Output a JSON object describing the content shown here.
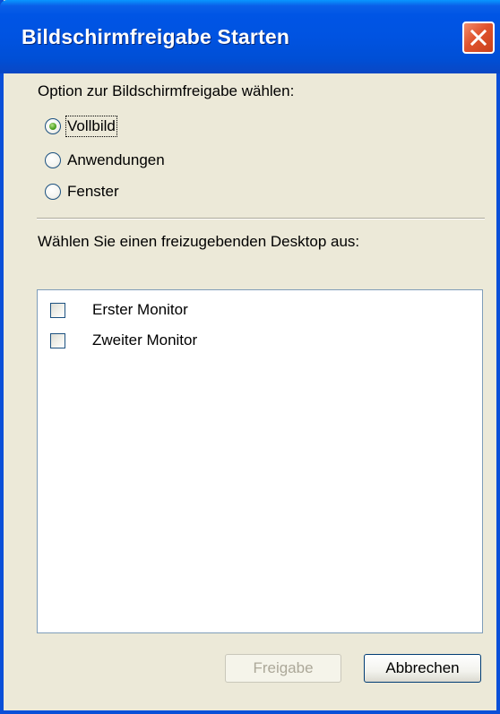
{
  "window": {
    "title": "Bildschirmfreigabe Starten",
    "close_icon": "close-x-icon"
  },
  "share_option": {
    "heading": "Option zur Bildschirmfreigabe wählen:",
    "options": [
      {
        "label": "Vollbild",
        "checked": true
      },
      {
        "label": "Anwendungen",
        "checked": false
      },
      {
        "label": "Fenster",
        "checked": false
      }
    ]
  },
  "desktop_select": {
    "heading": "Wählen Sie einen freizugebenden Desktop aus:",
    "monitors": [
      {
        "label": "Erster Monitor",
        "checked": false
      },
      {
        "label": "Zweiter Monitor",
        "checked": false
      }
    ]
  },
  "buttons": {
    "share_label": "Freigabe",
    "share_enabled": false,
    "cancel_label": "Abbrechen"
  },
  "colors": {
    "titlebar": "#0055e5",
    "close_button": "#e0532d",
    "dialog_background": "#ece9d8",
    "radio_selected": "#4aa11e"
  }
}
